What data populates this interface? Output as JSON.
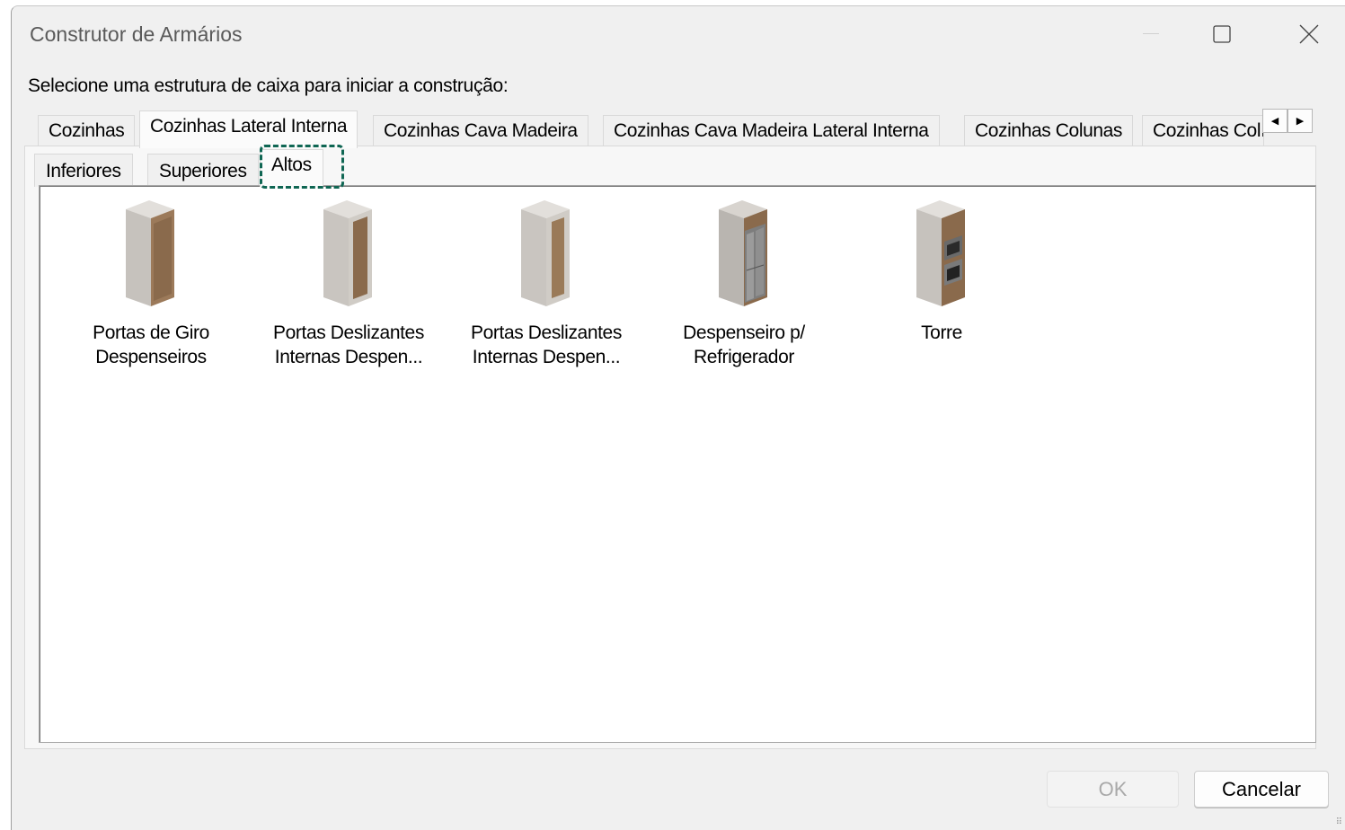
{
  "window": {
    "title": "Construtor de Armários"
  },
  "prompt": "Selecione uma estrutura de caixa para iniciar a construção:",
  "tabs": [
    {
      "label": "Cozinhas"
    },
    {
      "label": "Cozinhas Lateral Interna"
    },
    {
      "label": "Cozinhas Cava Madeira"
    },
    {
      "label": "Cozinhas Cava Madeira Lateral Interna"
    },
    {
      "label": "Cozinhas Colunas"
    },
    {
      "label": "Cozinhas Colı"
    }
  ],
  "active_tab": "Cozinhas Lateral Interna",
  "subtabs": [
    {
      "label": "Inferiores"
    },
    {
      "label": "Superiores"
    },
    {
      "label": "Altos"
    }
  ],
  "active_subtab": "Altos",
  "items": [
    {
      "label_line1": "Portas de Giro",
      "label_line2": "Despenseiros",
      "icon": "tall-cabinet-swing-doors-icon"
    },
    {
      "label_line1": "Portas Deslizantes",
      "label_line2": "Internas Despen...",
      "icon": "tall-cabinet-sliding-doors-icon"
    },
    {
      "label_line1": "Portas Deslizantes",
      "label_line2": "Internas Despen...",
      "icon": "tall-cabinet-sliding-doors-icon"
    },
    {
      "label_line1": "Despenseiro p/",
      "label_line2": "Refrigerador",
      "icon": "refrigerator-cabinet-icon"
    },
    {
      "label_line1": "Torre",
      "label_line2": "",
      "icon": "oven-tower-icon"
    }
  ],
  "buttons": {
    "ok": "OK",
    "cancel": "Cancelar"
  },
  "colors": {
    "highlight": "#0f6653",
    "wood": "#8a6a4c",
    "carcass": "#c9c5c0"
  }
}
